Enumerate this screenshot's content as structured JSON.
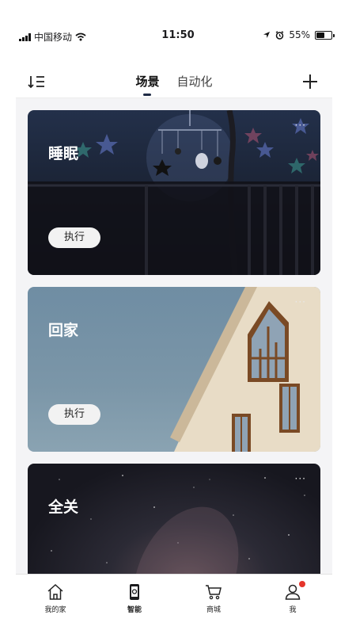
{
  "status_bar": {
    "carrier": "中国移动",
    "time": "11:50",
    "battery": "55%",
    "battery_level": 0.55
  },
  "header": {
    "tabs": [
      {
        "label": "场景",
        "active": true
      },
      {
        "label": "自动化",
        "active": false
      }
    ]
  },
  "scenes": [
    {
      "title": "睡眠",
      "more": "···",
      "action": "执行"
    },
    {
      "title": "回家",
      "more": "···",
      "action": "执行"
    },
    {
      "title": "全关",
      "more": "···"
    }
  ],
  "tabbar": {
    "items": [
      {
        "label": "我的家",
        "icon": "home-icon",
        "active": false
      },
      {
        "label": "智能",
        "icon": "phone-icon",
        "active": true
      },
      {
        "label": "商城",
        "icon": "cart-icon",
        "active": false
      },
      {
        "label": "我",
        "icon": "profile-icon",
        "active": false,
        "badge": true
      }
    ]
  },
  "colors": {
    "accent": "#1f2a44",
    "badge": "#e5352b",
    "background": "#f4f4f6"
  }
}
